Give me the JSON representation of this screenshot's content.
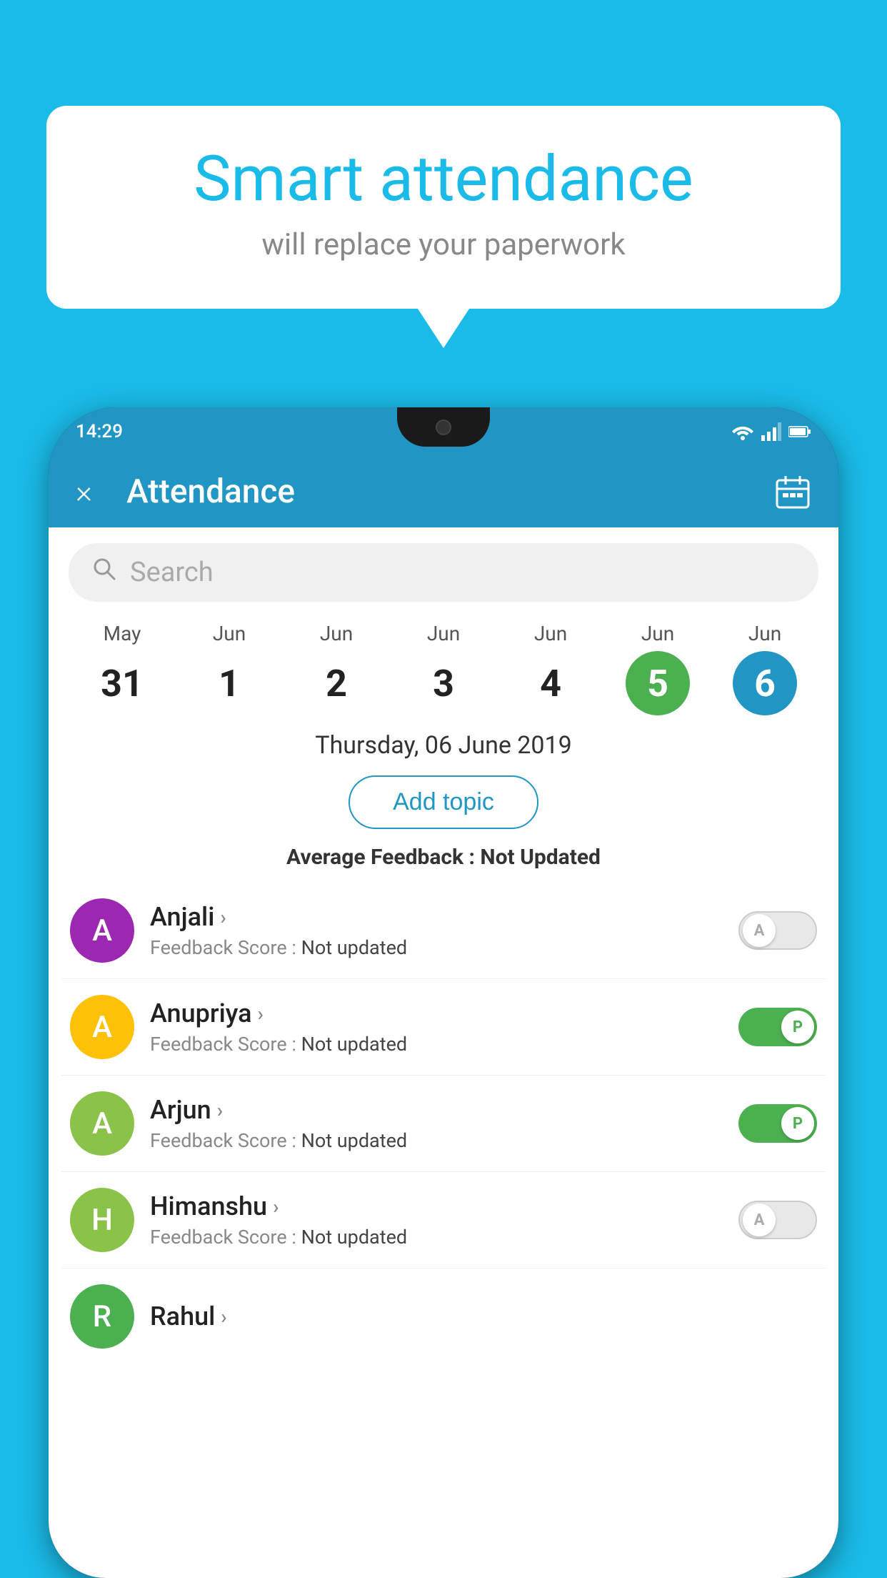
{
  "background_color": "#1ABBE8",
  "bubble": {
    "title": "Smart attendance",
    "subtitle": "will replace your paperwork"
  },
  "phone": {
    "status_time": "14:29",
    "status_icons": [
      "wifi",
      "signal",
      "battery"
    ]
  },
  "app": {
    "header_title": "Attendance",
    "close_label": "×",
    "calendar_icon": "📅"
  },
  "search": {
    "placeholder": "Search"
  },
  "dates": [
    {
      "month": "May",
      "day": "31",
      "type": "normal"
    },
    {
      "month": "Jun",
      "day": "1",
      "type": "normal"
    },
    {
      "month": "Jun",
      "day": "2",
      "type": "normal"
    },
    {
      "month": "Jun",
      "day": "3",
      "type": "normal"
    },
    {
      "month": "Jun",
      "day": "4",
      "type": "normal"
    },
    {
      "month": "Jun",
      "day": "5",
      "type": "today"
    },
    {
      "month": "Jun",
      "day": "6",
      "type": "selected"
    }
  ],
  "selected_date_label": "Thursday, 06 June 2019",
  "add_topic_label": "Add topic",
  "avg_feedback_label": "Average Feedback :",
  "avg_feedback_value": "Not Updated",
  "students": [
    {
      "name": "Anjali",
      "avatar_letter": "A",
      "avatar_color": "#9C27B0",
      "feedback_label": "Feedback Score :",
      "feedback_value": "Not updated",
      "toggle_state": "off",
      "toggle_label": "A"
    },
    {
      "name": "Anupriya",
      "avatar_letter": "A",
      "avatar_color": "#FFC107",
      "feedback_label": "Feedback Score :",
      "feedback_value": "Not updated",
      "toggle_state": "on",
      "toggle_label": "P"
    },
    {
      "name": "Arjun",
      "avatar_letter": "A",
      "avatar_color": "#8BC34A",
      "feedback_label": "Feedback Score :",
      "feedback_value": "Not updated",
      "toggle_state": "on",
      "toggle_label": "P"
    },
    {
      "name": "Himanshu",
      "avatar_letter": "H",
      "avatar_color": "#8BC34A",
      "feedback_label": "Feedback Score :",
      "feedback_value": "Not updated",
      "toggle_state": "off",
      "toggle_label": "A"
    }
  ]
}
